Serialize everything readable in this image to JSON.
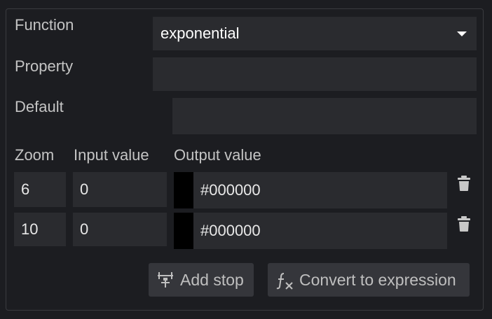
{
  "function": {
    "label": "Function",
    "value": "exponential",
    "icon": "chevron-down-icon"
  },
  "property": {
    "label": "Property",
    "value": ""
  },
  "default": {
    "label": "Default",
    "value": ""
  },
  "stops_header": {
    "zoom": "Zoom",
    "input_value": "Input value",
    "output_value": "Output value"
  },
  "stops": [
    {
      "zoom": "6",
      "input": "0",
      "output": "#000000",
      "swatch_color": "#000000",
      "delete_icon": "trash-icon"
    },
    {
      "zoom": "10",
      "input": "0",
      "output": "#000000",
      "swatch_color": "#000000",
      "delete_icon": "trash-icon"
    }
  ],
  "actions": {
    "add_stop": {
      "label": "Add stop",
      "icon": "add-stop-icon"
    },
    "convert": {
      "label": "Convert to expression",
      "icon": "function-icon"
    }
  }
}
